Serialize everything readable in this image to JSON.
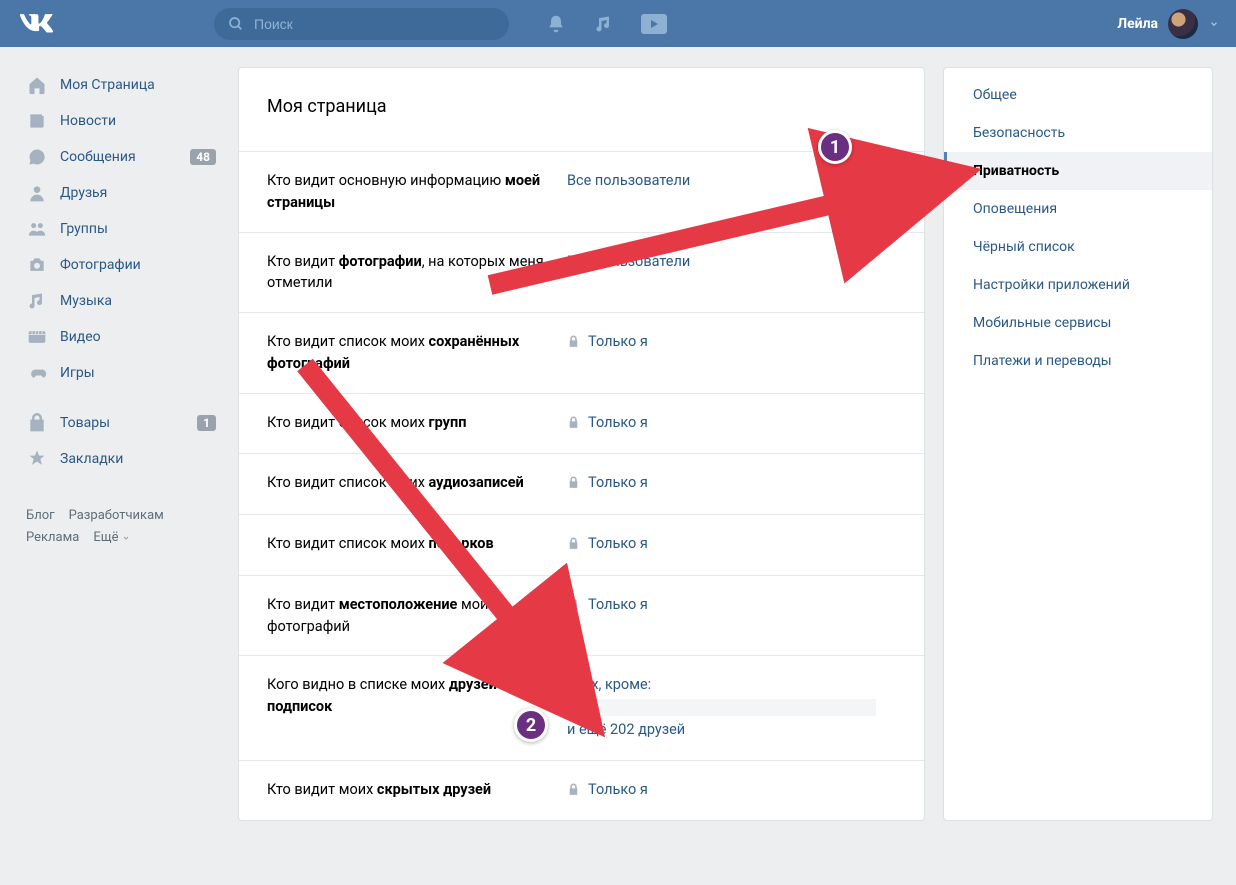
{
  "header": {
    "search_placeholder": "Поиск",
    "username": "Лейла"
  },
  "leftnav": {
    "items": [
      {
        "label": "Моя Страница",
        "icon": "home-icon"
      },
      {
        "label": "Новости",
        "icon": "news-icon"
      },
      {
        "label": "Сообщения",
        "icon": "messages-icon",
        "badge": "48"
      },
      {
        "label": "Друзья",
        "icon": "friends-icon"
      },
      {
        "label": "Группы",
        "icon": "groups-icon"
      },
      {
        "label": "Фотографии",
        "icon": "photos-icon"
      },
      {
        "label": "Музыка",
        "icon": "music-icon"
      },
      {
        "label": "Видео",
        "icon": "video-icon"
      },
      {
        "label": "Игры",
        "icon": "games-icon"
      }
    ],
    "items2": [
      {
        "label": "Товары",
        "icon": "market-icon",
        "badge": "1"
      },
      {
        "label": "Закладки",
        "icon": "bookmarks-icon"
      }
    ],
    "footer": {
      "blog": "Блог",
      "dev": "Разработчикам",
      "ads": "Реклама",
      "more": "Ещё"
    }
  },
  "main": {
    "title": "Моя страница",
    "rows": [
      {
        "label_pre": "Кто видит основную информацию ",
        "label_bold": "моей страницы",
        "value": "Все пользователи",
        "lock": false
      },
      {
        "label_pre": "Кто видит ",
        "label_bold": "фотографии",
        "label_post": ", на которых меня отметили",
        "value": "Все пользователи",
        "lock": false
      },
      {
        "label_pre": "Кто видит список моих ",
        "label_bold": "сохранённых фотографий",
        "value": "Только я",
        "lock": true
      },
      {
        "label_pre": "Кто видит список моих ",
        "label_bold": "групп",
        "value": "Только я",
        "lock": true
      },
      {
        "label_pre": "Кто видит список моих ",
        "label_bold": "аудиозаписей",
        "value": "Только я",
        "lock": true
      },
      {
        "label_pre": "Кто видит список моих ",
        "label_bold": "подарков",
        "value": "Только я",
        "lock": true
      },
      {
        "label_pre": "Кто видит ",
        "label_bold": "местоположение",
        "label_post": " моих фотографий",
        "value": "Только я",
        "lock": true
      }
    ],
    "friends_row": {
      "label_pre": "Кого видно в списке моих ",
      "label_bold": "друзей и подписок",
      "value_lead": "Всех, кроме:",
      "value_tail": " и ещё 202 друзей"
    },
    "hidden_row": {
      "label_pre": "Кто видит моих ",
      "label_bold": "скрытых друзей",
      "value": "Только я",
      "lock": true
    }
  },
  "tabs": {
    "items": [
      "Общее",
      "Безопасность",
      "Приватность",
      "Оповещения",
      "Чёрный список",
      "Настройки приложений",
      "Мобильные сервисы",
      "Платежи и переводы"
    ],
    "active_index": 2
  },
  "annotations": {
    "badge1": "1",
    "badge2": "2"
  }
}
